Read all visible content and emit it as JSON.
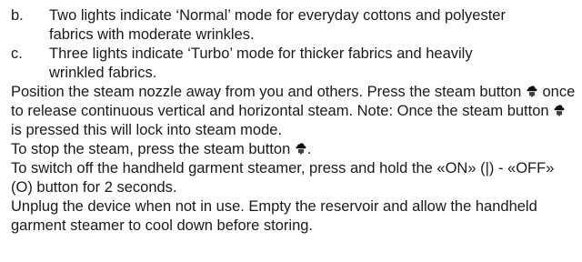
{
  "list_items": [
    {
      "letter": "b.",
      "text": "Two lights indicate ‘Normal’ mode for everyday cottons and polyester fabrics with moderate wrinkles."
    },
    {
      "letter": "c.",
      "text": "Three lights indicate ‘Turbo’ mode for thicker fabrics and heavily wrinkled fabrics."
    }
  ],
  "paragraphs": {
    "p1_a": "Position the steam nozzle away from you and others. Press the steam button",
    "p1_b": "once to release continuous vertical and horizontal steam. Note: Once the steam button",
    "p1_c": "is pressed this will lock into steam mode.",
    "p2_a": "To stop the steam, press the steam button",
    "p2_b": ".",
    "p3": "To switch off the handheld garment steamer, press and hold the «ON» (|) - «OFF» (O) button for 2 seconds.",
    "p4": "Unplug the device when not in use. Empty the reservoir and allow the handheld garment steamer to cool down before storing."
  },
  "icons": {
    "steam_button": "steam-cloud-icon"
  }
}
